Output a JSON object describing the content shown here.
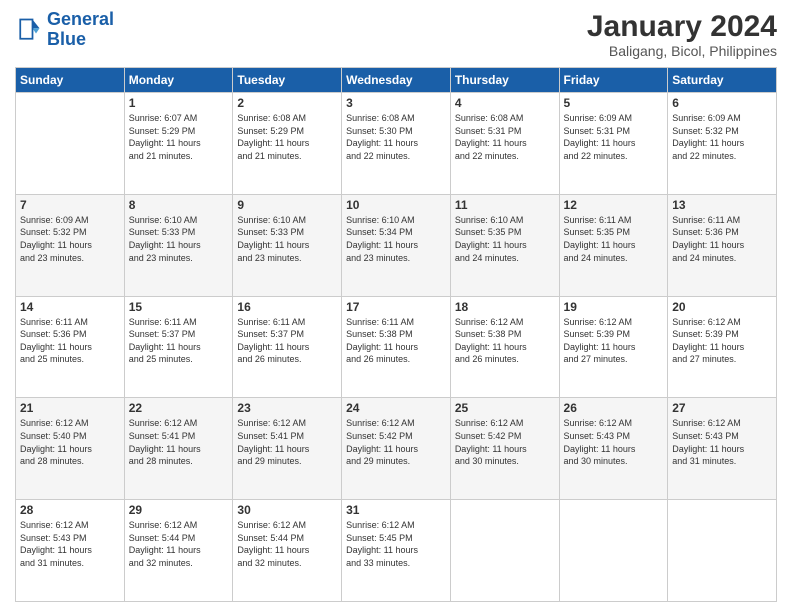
{
  "logo": {
    "line1": "General",
    "line2": "Blue"
  },
  "header": {
    "month_year": "January 2024",
    "location": "Baligang, Bicol, Philippines"
  },
  "days_of_week": [
    "Sunday",
    "Monday",
    "Tuesday",
    "Wednesday",
    "Thursday",
    "Friday",
    "Saturday"
  ],
  "weeks": [
    [
      {
        "day": "",
        "content": ""
      },
      {
        "day": "1",
        "content": "Sunrise: 6:07 AM\nSunset: 5:29 PM\nDaylight: 11 hours\nand 21 minutes."
      },
      {
        "day": "2",
        "content": "Sunrise: 6:08 AM\nSunset: 5:29 PM\nDaylight: 11 hours\nand 21 minutes."
      },
      {
        "day": "3",
        "content": "Sunrise: 6:08 AM\nSunset: 5:30 PM\nDaylight: 11 hours\nand 22 minutes."
      },
      {
        "day": "4",
        "content": "Sunrise: 6:08 AM\nSunset: 5:31 PM\nDaylight: 11 hours\nand 22 minutes."
      },
      {
        "day": "5",
        "content": "Sunrise: 6:09 AM\nSunset: 5:31 PM\nDaylight: 11 hours\nand 22 minutes."
      },
      {
        "day": "6",
        "content": "Sunrise: 6:09 AM\nSunset: 5:32 PM\nDaylight: 11 hours\nand 22 minutes."
      }
    ],
    [
      {
        "day": "7",
        "content": "Sunrise: 6:09 AM\nSunset: 5:32 PM\nDaylight: 11 hours\nand 23 minutes."
      },
      {
        "day": "8",
        "content": "Sunrise: 6:10 AM\nSunset: 5:33 PM\nDaylight: 11 hours\nand 23 minutes."
      },
      {
        "day": "9",
        "content": "Sunrise: 6:10 AM\nSunset: 5:33 PM\nDaylight: 11 hours\nand 23 minutes."
      },
      {
        "day": "10",
        "content": "Sunrise: 6:10 AM\nSunset: 5:34 PM\nDaylight: 11 hours\nand 23 minutes."
      },
      {
        "day": "11",
        "content": "Sunrise: 6:10 AM\nSunset: 5:35 PM\nDaylight: 11 hours\nand 24 minutes."
      },
      {
        "day": "12",
        "content": "Sunrise: 6:11 AM\nSunset: 5:35 PM\nDaylight: 11 hours\nand 24 minutes."
      },
      {
        "day": "13",
        "content": "Sunrise: 6:11 AM\nSunset: 5:36 PM\nDaylight: 11 hours\nand 24 minutes."
      }
    ],
    [
      {
        "day": "14",
        "content": "Sunrise: 6:11 AM\nSunset: 5:36 PM\nDaylight: 11 hours\nand 25 minutes."
      },
      {
        "day": "15",
        "content": "Sunrise: 6:11 AM\nSunset: 5:37 PM\nDaylight: 11 hours\nand 25 minutes."
      },
      {
        "day": "16",
        "content": "Sunrise: 6:11 AM\nSunset: 5:37 PM\nDaylight: 11 hours\nand 26 minutes."
      },
      {
        "day": "17",
        "content": "Sunrise: 6:11 AM\nSunset: 5:38 PM\nDaylight: 11 hours\nand 26 minutes."
      },
      {
        "day": "18",
        "content": "Sunrise: 6:12 AM\nSunset: 5:38 PM\nDaylight: 11 hours\nand 26 minutes."
      },
      {
        "day": "19",
        "content": "Sunrise: 6:12 AM\nSunset: 5:39 PM\nDaylight: 11 hours\nand 27 minutes."
      },
      {
        "day": "20",
        "content": "Sunrise: 6:12 AM\nSunset: 5:39 PM\nDaylight: 11 hours\nand 27 minutes."
      }
    ],
    [
      {
        "day": "21",
        "content": "Sunrise: 6:12 AM\nSunset: 5:40 PM\nDaylight: 11 hours\nand 28 minutes."
      },
      {
        "day": "22",
        "content": "Sunrise: 6:12 AM\nSunset: 5:41 PM\nDaylight: 11 hours\nand 28 minutes."
      },
      {
        "day": "23",
        "content": "Sunrise: 6:12 AM\nSunset: 5:41 PM\nDaylight: 11 hours\nand 29 minutes."
      },
      {
        "day": "24",
        "content": "Sunrise: 6:12 AM\nSunset: 5:42 PM\nDaylight: 11 hours\nand 29 minutes."
      },
      {
        "day": "25",
        "content": "Sunrise: 6:12 AM\nSunset: 5:42 PM\nDaylight: 11 hours\nand 30 minutes."
      },
      {
        "day": "26",
        "content": "Sunrise: 6:12 AM\nSunset: 5:43 PM\nDaylight: 11 hours\nand 30 minutes."
      },
      {
        "day": "27",
        "content": "Sunrise: 6:12 AM\nSunset: 5:43 PM\nDaylight: 11 hours\nand 31 minutes."
      }
    ],
    [
      {
        "day": "28",
        "content": "Sunrise: 6:12 AM\nSunset: 5:43 PM\nDaylight: 11 hours\nand 31 minutes."
      },
      {
        "day": "29",
        "content": "Sunrise: 6:12 AM\nSunset: 5:44 PM\nDaylight: 11 hours\nand 32 minutes."
      },
      {
        "day": "30",
        "content": "Sunrise: 6:12 AM\nSunset: 5:44 PM\nDaylight: 11 hours\nand 32 minutes."
      },
      {
        "day": "31",
        "content": "Sunrise: 6:12 AM\nSunset: 5:45 PM\nDaylight: 11 hours\nand 33 minutes."
      },
      {
        "day": "",
        "content": ""
      },
      {
        "day": "",
        "content": ""
      },
      {
        "day": "",
        "content": ""
      }
    ]
  ]
}
